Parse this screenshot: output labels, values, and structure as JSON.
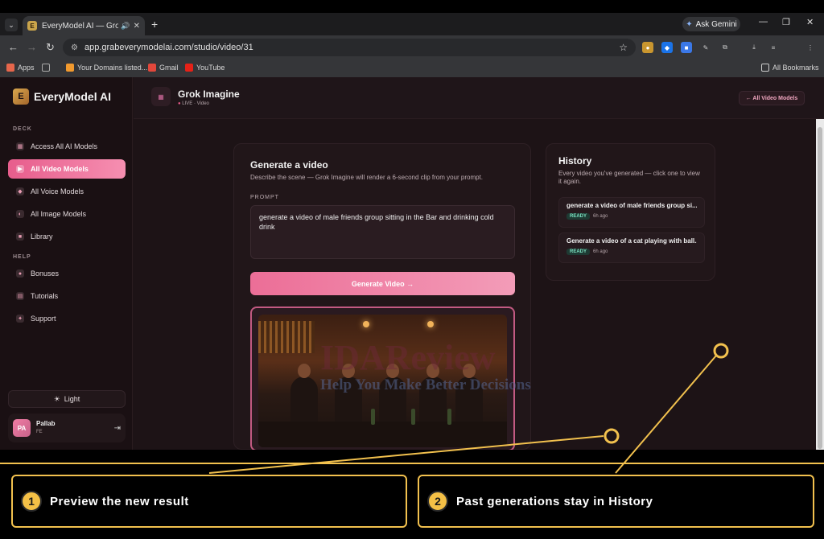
{
  "browser": {
    "tab_title": "EveryModel AI — Grok Ima",
    "ask_gemini": "Ask Gemini",
    "url": "app.grabeverymodelai.com/studio/video/31",
    "bookmarks": [
      {
        "label": "Apps",
        "color": "#e6664b"
      },
      {
        "label": "",
        "color": "#aaaaaa"
      },
      {
        "label": "Your Domains listed...",
        "color": "#f29a2e"
      },
      {
        "label": "Gmail",
        "color": "#e2473b"
      },
      {
        "label": "YouTube",
        "color": "#e62117"
      }
    ],
    "all_bookmarks": "All Bookmarks"
  },
  "sidebar": {
    "logo": "EveryModel AI",
    "deck_label": "DECK",
    "deck_items": [
      {
        "label": "Access All AI Models",
        "icon": "grid-icon"
      },
      {
        "label": "All Video Models",
        "icon": "play-icon"
      },
      {
        "label": "All Voice Models",
        "icon": "mic-icon"
      },
      {
        "label": "All Image Models",
        "icon": "image-icon"
      },
      {
        "label": "Library",
        "icon": "library-icon"
      }
    ],
    "help_label": "HELP",
    "help_items": [
      {
        "label": "Bonuses",
        "icon": "gift-icon"
      },
      {
        "label": "Tutorials",
        "icon": "book-icon"
      },
      {
        "label": "Support",
        "icon": "support-icon"
      }
    ],
    "theme_toggle": "Light",
    "user": {
      "initials": "PA",
      "name": "Pallab",
      "sub": "FE"
    }
  },
  "header": {
    "model_title": "Grok Imagine",
    "status": "LIVE · Video",
    "back_button": "← All Video Models"
  },
  "generator": {
    "title": "Generate a video",
    "description": "Describe the scene — Grok Imagine will render a 6-second clip from your prompt.",
    "prompt_label": "PROMPT",
    "prompt_value": "generate a video of male friends group sitting in the Bar and drinking cold drink",
    "button": "Generate Video →"
  },
  "history": {
    "title": "History",
    "description": "Every video you've generated — click one to view it again.",
    "items": [
      {
        "title": "generate a video of male friends group si...",
        "status": "READY",
        "age": "6h ago"
      },
      {
        "title": "Generate a video of a cat playing with ball...",
        "status": "READY",
        "age": "6h ago"
      }
    ]
  },
  "watermark": {
    "brand": "IDAReview",
    "tagline": "Help You Make Better Decisions"
  },
  "callouts": [
    {
      "num": "1",
      "text": "Preview the new result"
    },
    {
      "num": "2",
      "text": "Past generations stay in History"
    }
  ],
  "colors": {
    "accent": "#ec6e97",
    "callout": "#f2c14e",
    "ready": "#7be0c0"
  }
}
